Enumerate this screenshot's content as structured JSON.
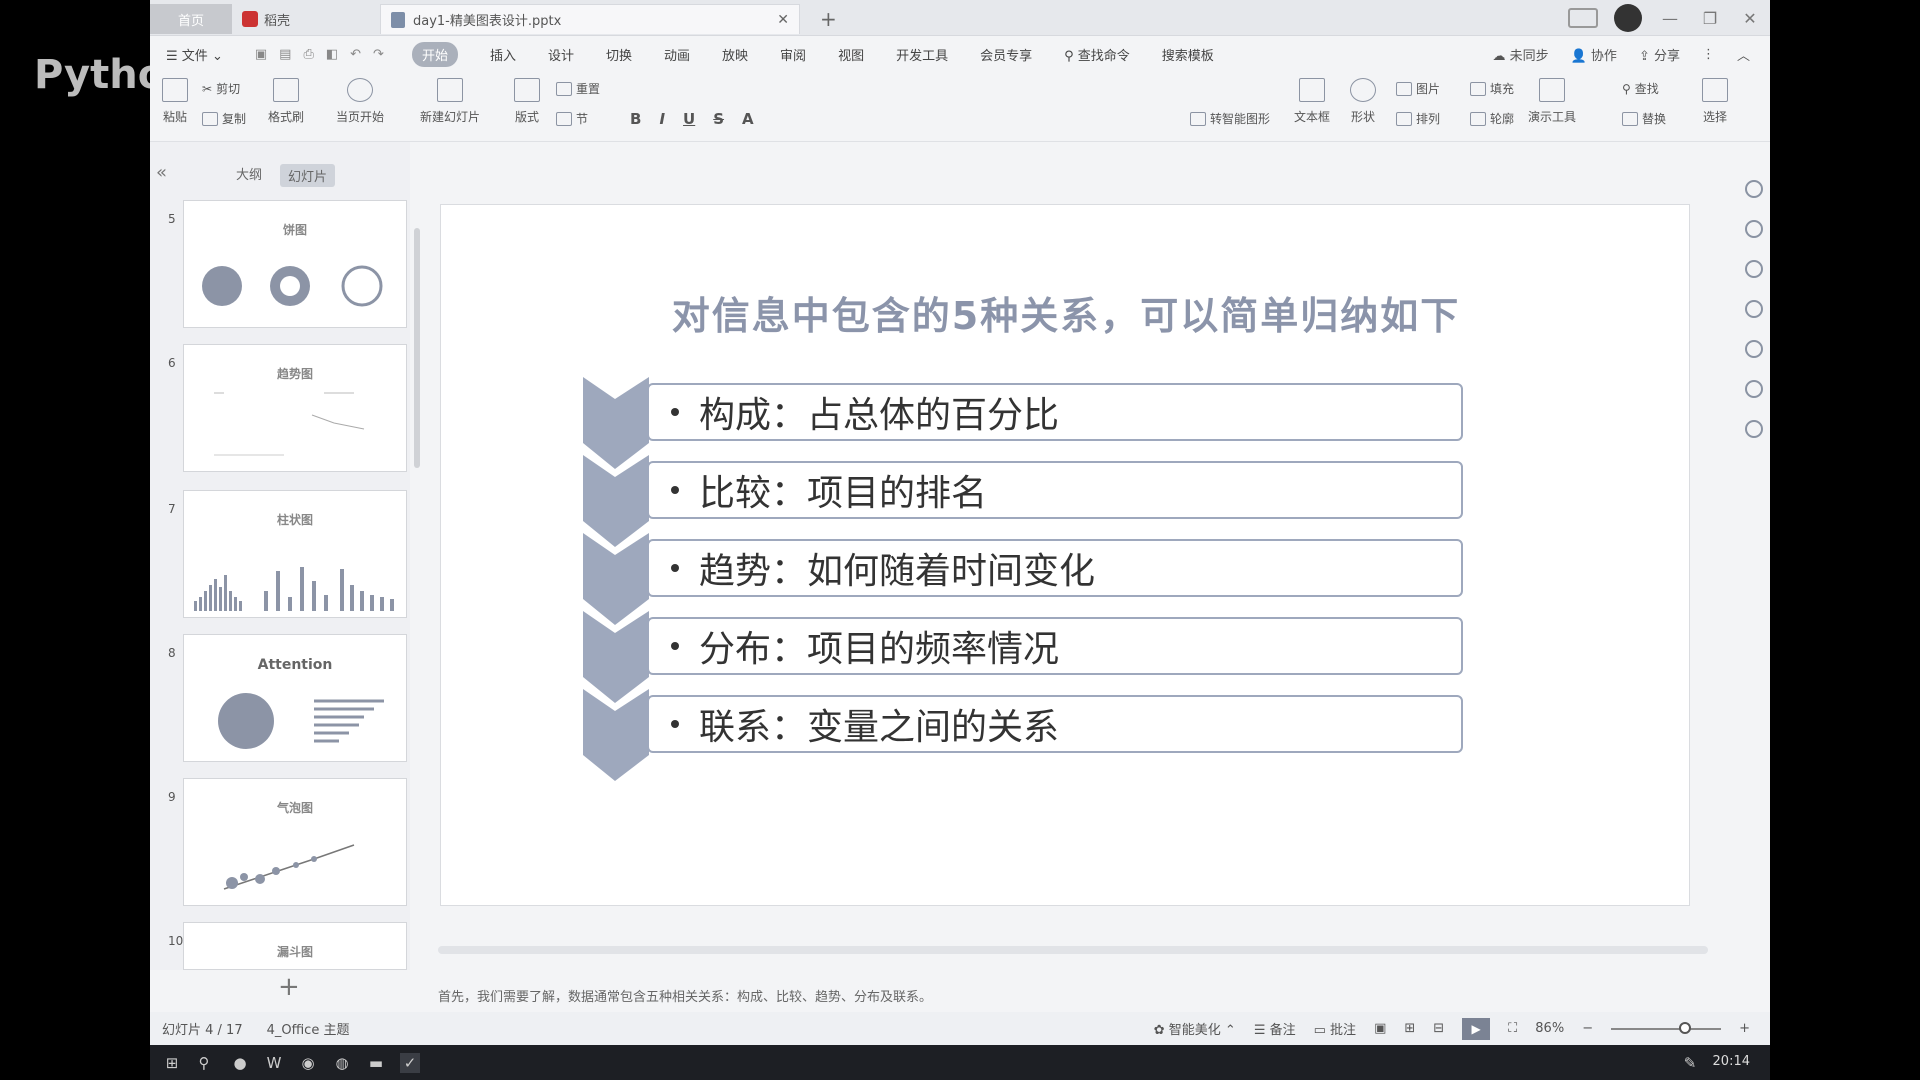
{
  "overlay": {
    "text": "Pythor"
  },
  "tabs": {
    "home": "首页",
    "docer": "稻壳",
    "file": "day1-精美图表设计.pptx"
  },
  "menu": {
    "items": [
      "文件",
      "开始",
      "插入",
      "设计",
      "切换",
      "动画",
      "放映",
      "审阅",
      "视图",
      "开发工具",
      "会员专享",
      "查找命令",
      "搜索模板"
    ],
    "right": [
      "未同步",
      "协作",
      "分享"
    ]
  },
  "ribbon": {
    "paste": "粘贴",
    "cut": "剪切",
    "copy": "复制",
    "format_painter": "格式刷",
    "start_from_current": "当页开始",
    "new_slide": "新建幻灯片",
    "layout": "版式",
    "section": "节",
    "reset": "重置",
    "textbox": "文本框",
    "shape": "形状",
    "arrange": "排列",
    "picture": "图片",
    "fill": "填充",
    "outline": "轮廓",
    "present_tool": "演示工具",
    "find": "查找",
    "replace": "替换",
    "select": "选择",
    "convert_to_smartart": "转智能图形"
  },
  "left_panel": {
    "tabs": [
      "大纲",
      "幻灯片"
    ],
    "thumbnails": [
      {
        "num": "5",
        "title": "饼图"
      },
      {
        "num": "6",
        "title": "趋势图"
      },
      {
        "num": "7",
        "title": "柱状图"
      },
      {
        "num": "8",
        "title": "Attention"
      },
      {
        "num": "9",
        "title": "气泡图"
      },
      {
        "num": "10",
        "title": "漏斗图"
      }
    ]
  },
  "slide": {
    "title": "对信息中包含的5种关系，可以简单归纳如下",
    "items": [
      "构成：占总体的百分比",
      "比较：项目的排名",
      "趋势：如何随着时间变化",
      "分布：项目的频率情况",
      "联系：变量之间的关系"
    ]
  },
  "notes": "首先，我们需要了解，数据通常包含五种相关关系：构成、比较、趋势、分布及联系。",
  "status": {
    "slide_counter": "幻灯片 4 / 17",
    "theme": "4_Office 主题",
    "smart_beautify": "智能美化",
    "notes": "备注",
    "comments": "批注",
    "zoom": "86%"
  },
  "taskbar": {
    "time": "20:14"
  },
  "colors": {
    "chevron": "#9ea8bd",
    "title": "#8b94aa",
    "row_border": "#9ea8bd"
  }
}
